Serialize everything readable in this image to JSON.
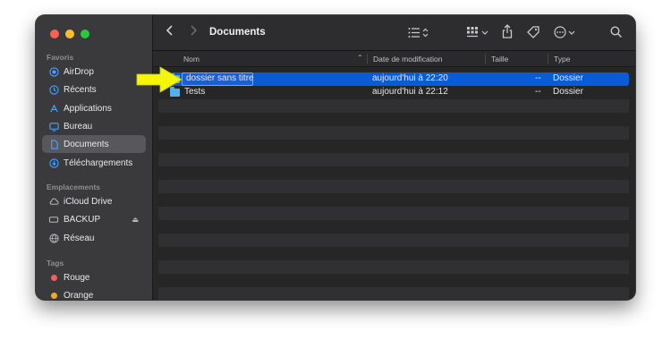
{
  "colors": {
    "close": "#ff5f57",
    "minimize": "#febc2e",
    "zoom": "#28c840",
    "selection": "#0a5bd6",
    "folder": "#54b1f0",
    "arrow": "#f5f50a"
  },
  "sidebar": {
    "favorites_title": "Favoris",
    "favorites": [
      {
        "label": "AirDrop",
        "icon": "airdrop-icon"
      },
      {
        "label": "Récents",
        "icon": "clock-icon"
      },
      {
        "label": "Applications",
        "icon": "applications-icon"
      },
      {
        "label": "Bureau",
        "icon": "desktop-icon"
      },
      {
        "label": "Documents",
        "icon": "document-icon",
        "selected": true
      },
      {
        "label": "Téléchargements",
        "icon": "download-icon"
      }
    ],
    "locations_title": "Emplacements",
    "locations": [
      {
        "label": "iCloud Drive",
        "icon": "cloud-icon"
      },
      {
        "label": "BACKUP",
        "icon": "drive-icon"
      },
      {
        "label": "Réseau",
        "icon": "network-icon"
      }
    ],
    "tags_title": "Tags",
    "tags": [
      {
        "label": "Rouge",
        "color": "#ff5b57"
      },
      {
        "label": "Orange",
        "color": "#f5a623"
      }
    ]
  },
  "toolbar": {
    "title": "Documents"
  },
  "columns": {
    "name": "Nom",
    "date": "Date de modification",
    "size": "Taille",
    "type": "Type"
  },
  "files": [
    {
      "name": "dossier sans titre",
      "date": "aujourd'hui à 22:20",
      "size": "--",
      "type": "Dossier",
      "selected": true,
      "renaming": true
    },
    {
      "name": "Tests",
      "date": "aujourd'hui à 22:12",
      "size": "--",
      "type": "Dossier",
      "selected": false
    }
  ]
}
